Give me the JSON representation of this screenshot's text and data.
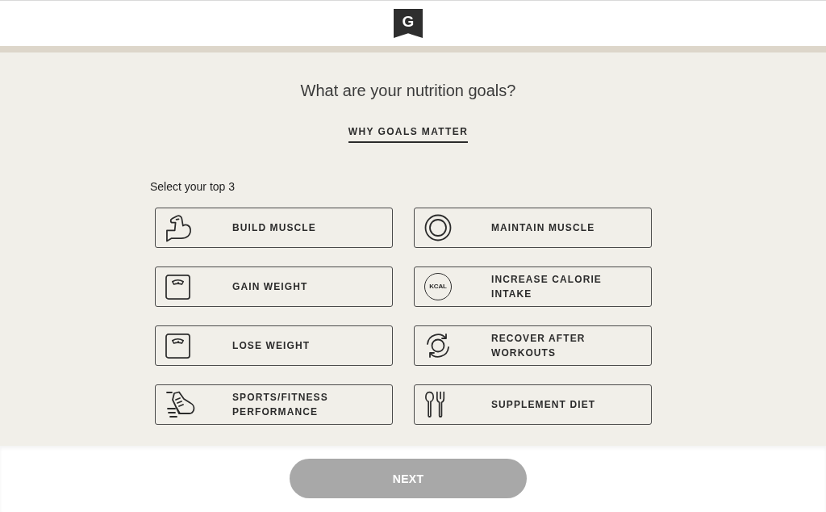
{
  "header": {
    "logo": "G"
  },
  "title": "What are your nutrition goals?",
  "info_link": "WHY GOALS MATTER",
  "instruction": "Select your top 3",
  "goals": [
    {
      "label": "BUILD MUSCLE",
      "selected": false
    },
    {
      "label": "MAINTAIN MUSCLE",
      "selected": false
    },
    {
      "label": "GAIN WEIGHT",
      "selected": false
    },
    {
      "label": "INCREASE CALORIE INTAKE",
      "selected": false,
      "icon_text": "KCAL"
    },
    {
      "label": "LOSE WEIGHT",
      "selected": false
    },
    {
      "label": "RECOVER AFTER WORKOUTS",
      "selected": false
    },
    {
      "label": "SPORTS/FITNESS PERFORMANCE",
      "selected": false
    },
    {
      "label": "SUPPLEMENT DIET",
      "selected": false
    }
  ],
  "next_button": {
    "label": "NEXT",
    "disabled": true
  }
}
